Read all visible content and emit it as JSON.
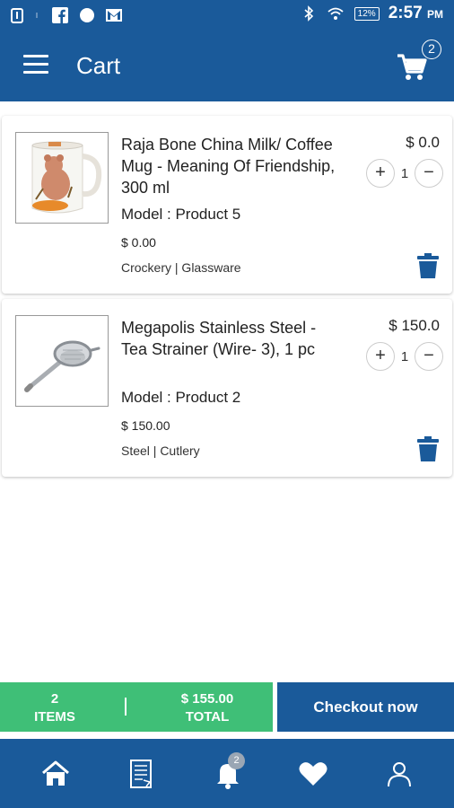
{
  "status_bar": {
    "battery": "12%",
    "time": "2:57",
    "ampm": "PM"
  },
  "header": {
    "title": "Cart",
    "cart_count": "2"
  },
  "cart_items": [
    {
      "name": "Raja Bone China Milk/ Coffee Mug - Meaning Of Friendship, 300 ml",
      "model": "Model : Product 5",
      "unit_price": "$ 0.00",
      "categories": "Crockery | Glassware",
      "line_total": "$ 0.0",
      "qty": "1",
      "plus": "+",
      "minus": "−"
    },
    {
      "name": "Megapolis Stainless Steel - Tea Strainer (Wire- 3), 1 pc",
      "model": "Model : Product 2",
      "unit_price": "$ 150.00",
      "categories": "Steel | Cutlery",
      "line_total": "$ 150.0",
      "qty": "1",
      "plus": "+",
      "minus": "−"
    }
  ],
  "summary": {
    "items_count": "2",
    "items_label": "ITEMS",
    "total_value": "$ 155.00",
    "total_label": "TOTAL",
    "checkout_label": "Checkout now"
  },
  "bottom_nav": {
    "notification_count": "2",
    "items": [
      "home-icon",
      "orders-icon",
      "bell-icon",
      "heart-icon",
      "profile-icon"
    ]
  },
  "colors": {
    "primary": "#1a5a9a",
    "summary_green": "#3fbf77",
    "delete_blue": "#1a5a9a"
  }
}
